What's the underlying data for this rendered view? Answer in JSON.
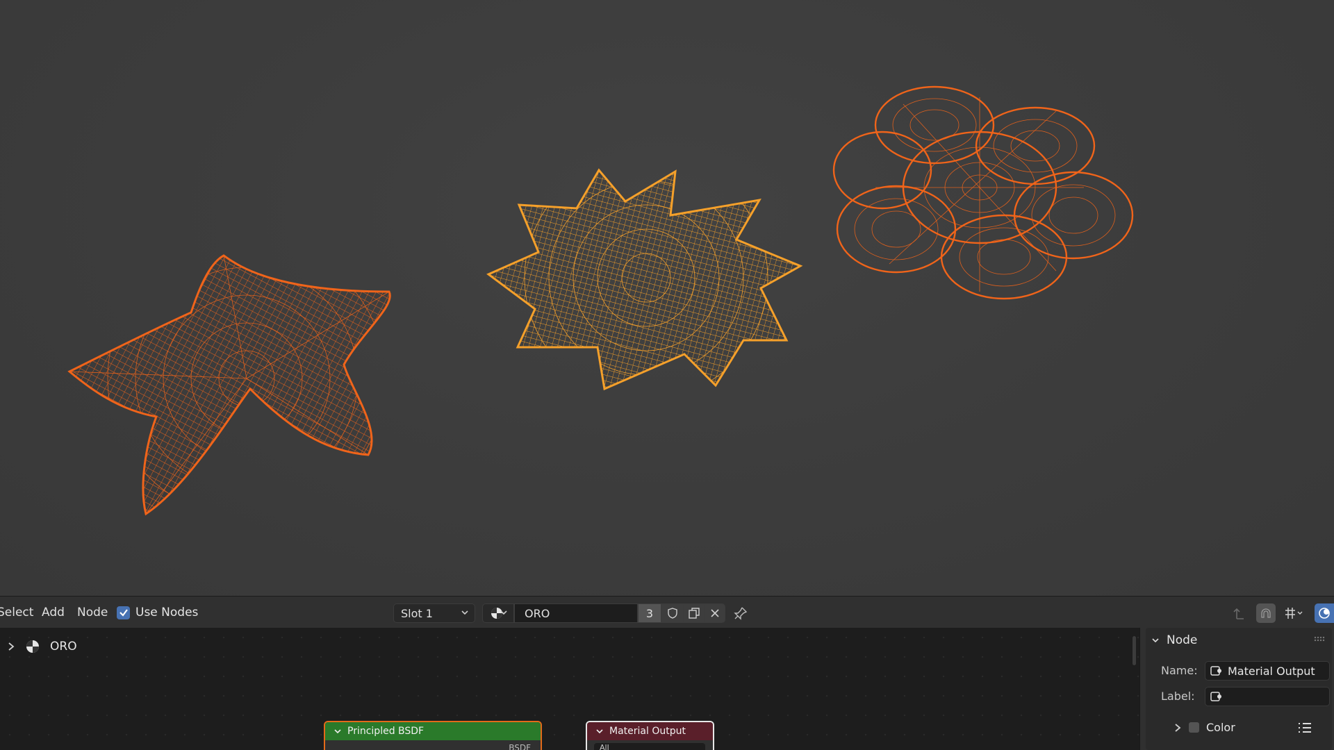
{
  "viewport": {
    "colors": {
      "background": "#3d3d3d",
      "wire_dark_orange": "#f0641a",
      "wire_light_orange": "#f5a02a"
    },
    "objects": [
      {
        "name": "starfish-wireframe",
        "color": "#f0641a"
      },
      {
        "name": "star-burst-wireframe",
        "color": "#f5a02a"
      },
      {
        "name": "cloud-flower-wireframe",
        "color": "#f0641a"
      }
    ]
  },
  "node_editor": {
    "menu": {
      "select": "Select",
      "add": "Add",
      "node": "Node"
    },
    "use_nodes": {
      "label": "Use Nodes",
      "checked": true
    },
    "slot": {
      "value": "Slot 1"
    },
    "material": {
      "name": "ORO",
      "users": "3"
    },
    "breadcrumb": {
      "label": "ORO"
    },
    "nodes": {
      "principled": {
        "title": "Principled BSDF",
        "output": "BSDF",
        "header_color": "#2a7a2a"
      },
      "output": {
        "title": "Material Output",
        "input": "All",
        "header_color": "#5a1f2a"
      }
    }
  },
  "sidebar": {
    "panel_title": "Node",
    "name_label": "Name:",
    "name_value": "Material Output",
    "label_label": "Label:",
    "label_value": "",
    "color_label": "Color"
  }
}
